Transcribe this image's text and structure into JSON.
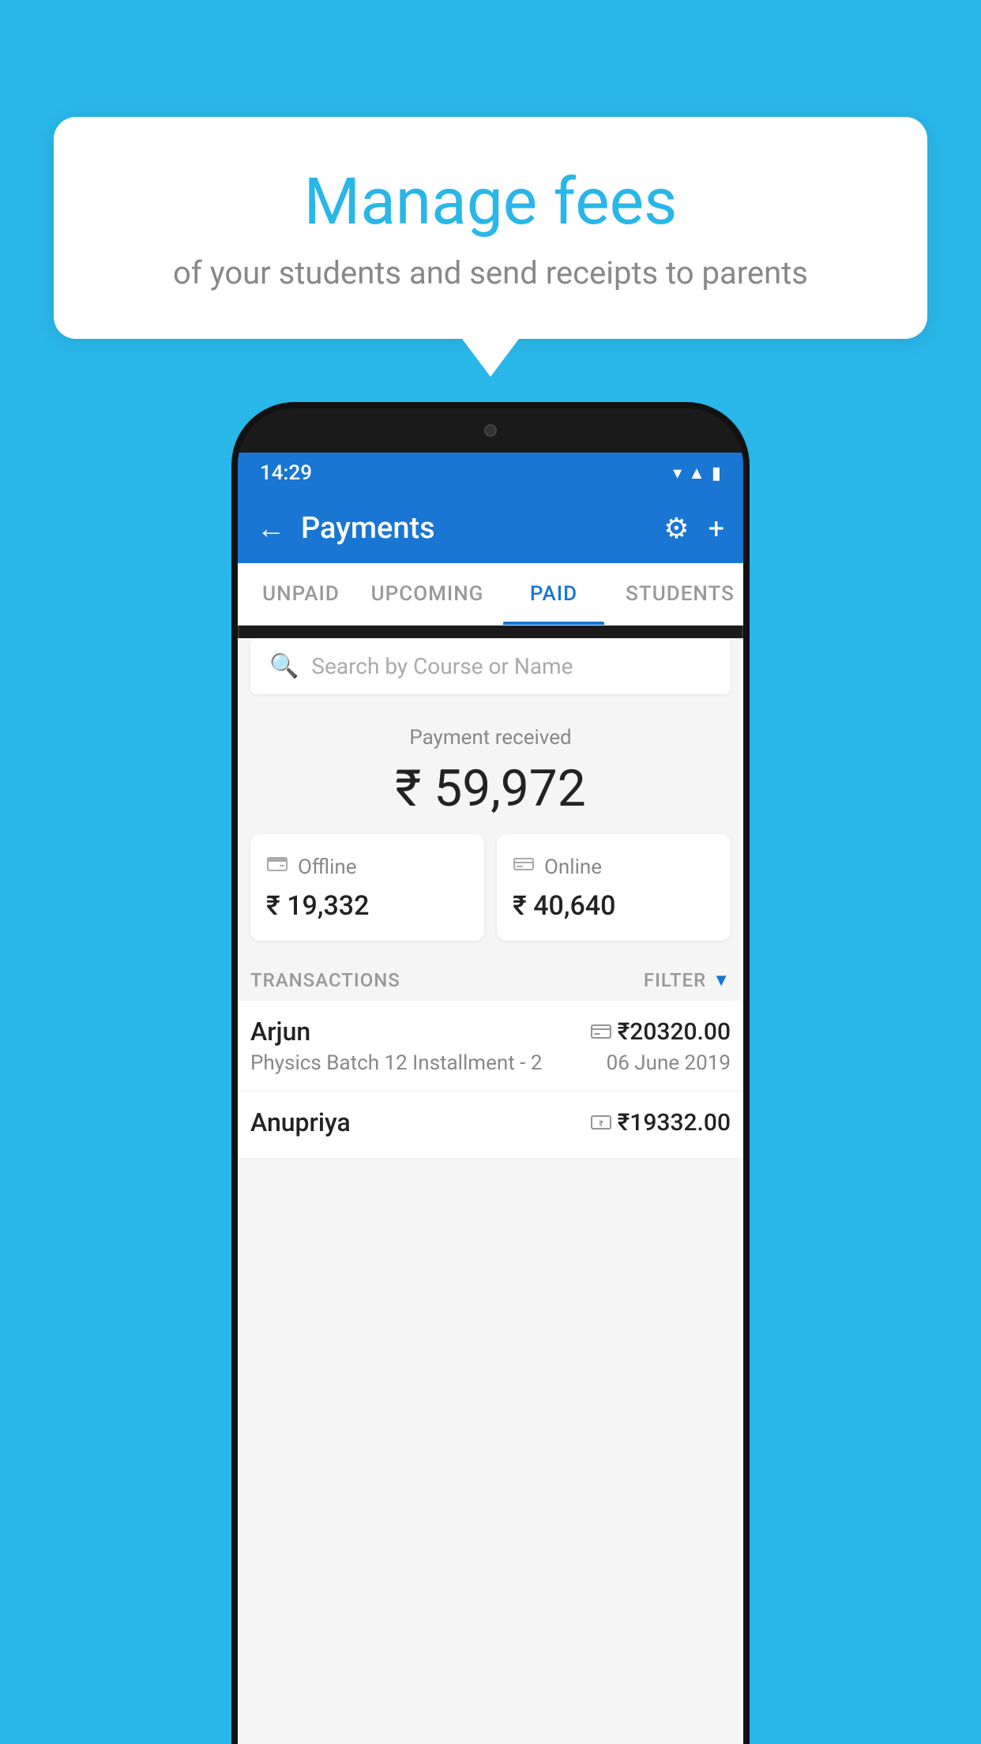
{
  "background_color": "#29b6e8",
  "speech_bubble": {
    "title": "Manage fees",
    "subtitle": "of your students and send receipts to parents"
  },
  "status_bar": {
    "time": "14:29",
    "icons": [
      "wifi",
      "signal",
      "battery"
    ]
  },
  "app_bar": {
    "title": "Payments",
    "back_label": "←",
    "settings_label": "⚙",
    "add_label": "+"
  },
  "tabs": [
    {
      "label": "UNPAID",
      "active": false
    },
    {
      "label": "UPCOMING",
      "active": false
    },
    {
      "label": "PAID",
      "active": true
    },
    {
      "label": "STUDENTS",
      "active": false
    }
  ],
  "search": {
    "placeholder": "Search by Course or Name"
  },
  "payment_summary": {
    "label": "Payment received",
    "amount": "₹ 59,972",
    "offline": {
      "label": "Offline",
      "amount": "₹ 19,332"
    },
    "online": {
      "label": "Online",
      "amount": "₹ 40,640"
    }
  },
  "transactions": {
    "section_label": "TRANSACTIONS",
    "filter_label": "FILTER",
    "rows": [
      {
        "name": "Arjun",
        "amount": "₹20320.00",
        "course": "Physics Batch 12 Installment - 2",
        "date": "06 June 2019",
        "payment_type": "card"
      },
      {
        "name": "Anupriya",
        "amount": "₹19332.00",
        "course": "",
        "date": "",
        "payment_type": "cash"
      }
    ]
  }
}
